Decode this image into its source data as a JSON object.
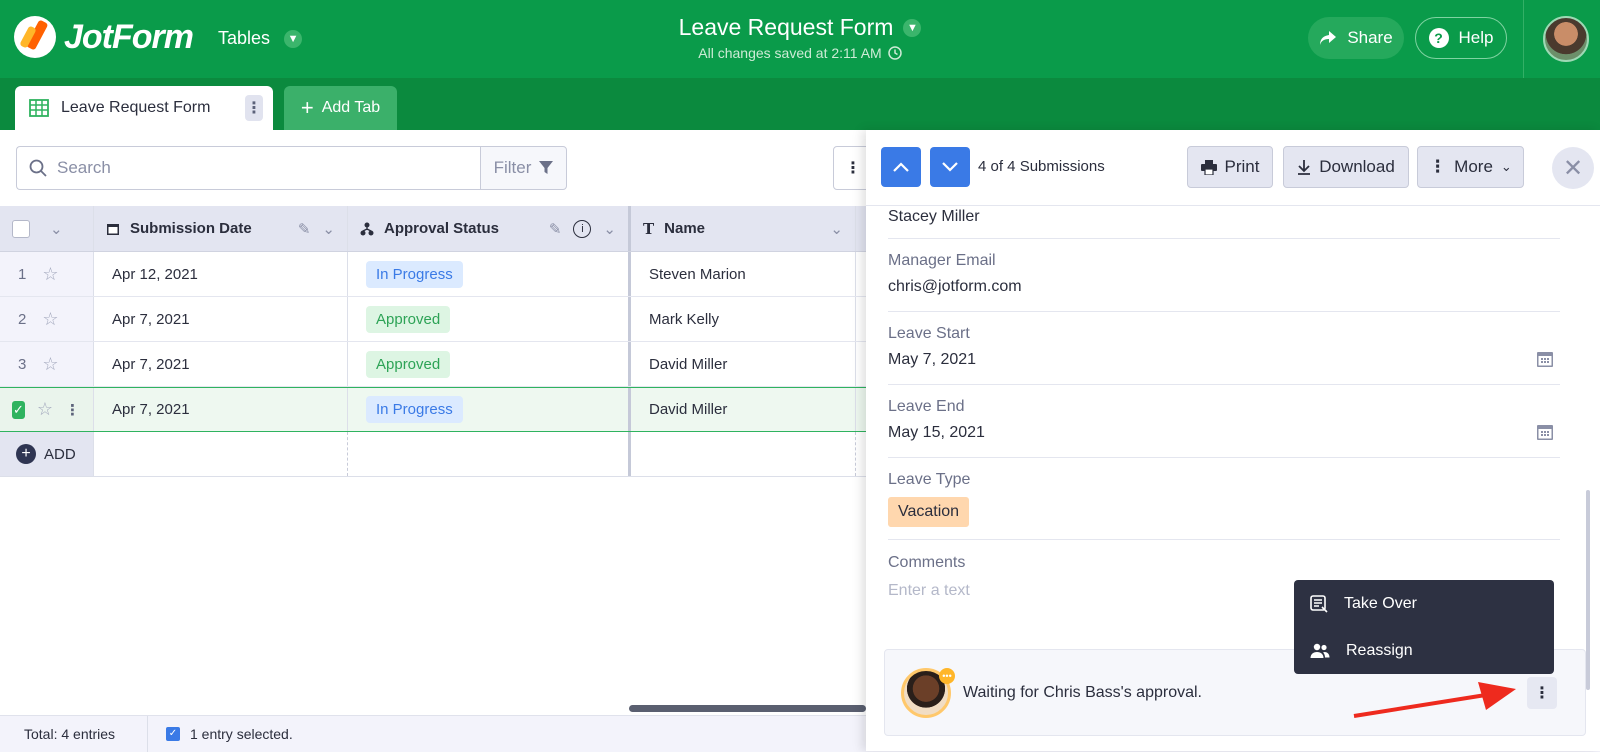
{
  "app": {
    "logo": "JotForm",
    "tables_menu": "Tables",
    "title": "Leave Request Form",
    "saved_status": "All changes saved at 2:11 AM"
  },
  "header": {
    "share_label": "Share",
    "help_label": "Help"
  },
  "tabs": [
    {
      "label": "Leave Request Form"
    }
  ],
  "add_tab_label": "Add Tab",
  "search": {
    "placeholder": "Search",
    "filter_label": "Filter"
  },
  "columns": [
    "Submission Date",
    "Approval Status",
    "Name"
  ],
  "rows": [
    {
      "num": "1",
      "date": "Apr 12, 2021",
      "status": "In Progress",
      "name": "Steven Marion"
    },
    {
      "num": "2",
      "date": "Apr 7, 2021",
      "status": "Approved",
      "name": "Mark Kelly"
    },
    {
      "num": "3",
      "date": "Apr 7, 2021",
      "status": "Approved",
      "name": "David Miller"
    },
    {
      "num": "",
      "date": "Apr 7, 2021",
      "status": "In Progress",
      "name": "David Miller"
    }
  ],
  "add_row_label": "ADD",
  "footer": {
    "total": "Total: 4 entries",
    "selected": "1 entry selected."
  },
  "panel": {
    "count": "4 of 4 Submissions",
    "print_label": "Print",
    "download_label": "Download",
    "more_label": "More",
    "fields": [
      {
        "label": "",
        "value": "Stacey Miller"
      },
      {
        "label": "Manager Email",
        "value": "chris@jotform.com"
      },
      {
        "label": "Leave Start",
        "value": "May 7, 2021"
      },
      {
        "label": "Leave End",
        "value": "May 15, 2021"
      },
      {
        "label": "Leave Type",
        "value": "Vacation"
      },
      {
        "label": "Comments",
        "value": "Enter a text"
      }
    ],
    "approval_text": "Waiting for Chris Bass's approval."
  },
  "menu": {
    "take_over": "Take Over",
    "reassign": "Reassign"
  },
  "colors": {
    "brand_green": "#0a9b4a",
    "accent_blue": "#3a7ae6",
    "vacation_tag": "#ffd7ae",
    "arrow_red": "#ee2a1e"
  }
}
